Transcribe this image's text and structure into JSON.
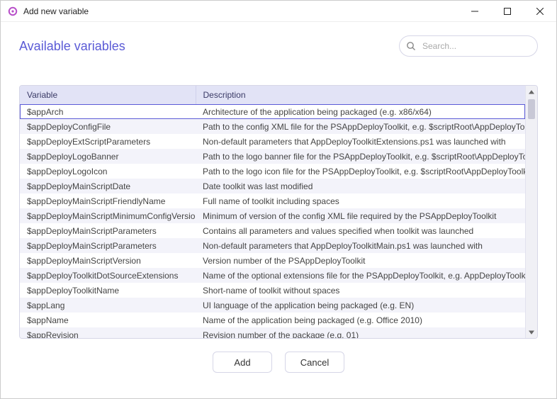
{
  "window": {
    "title": "Add new variable"
  },
  "heading": "Available variables",
  "search": {
    "placeholder": "Search..."
  },
  "table": {
    "headers": {
      "variable": "Variable",
      "description": "Description"
    },
    "rows": [
      {
        "variable": "$appArch",
        "description": "Architecture of the application being packaged (e.g. x86/x64)"
      },
      {
        "variable": "$appDeployConfigFile",
        "description": "Path to the config XML file for the PSAppDeployToolkit, e.g. $scriptRoot\\AppDeployToolkitCo"
      },
      {
        "variable": "$appDeployExtScriptParameters",
        "description": "Non-default parameters that AppDeployToolkitExtensions.ps1 was launched with"
      },
      {
        "variable": "$appDeployLogoBanner",
        "description": "Path to the logo banner file for the PSAppDeployToolkit, e.g. $scriptRoot\\AppDeployToolkitBa"
      },
      {
        "variable": "$appDeployLogoIcon",
        "description": "Path to the logo icon file for the PSAppDeployToolkit, e.g. $scriptRoot\\AppDeployToolkitLogo"
      },
      {
        "variable": "$appDeployMainScriptDate",
        "description": "Date toolkit was last modified"
      },
      {
        "variable": "$appDeployMainScriptFriendlyName",
        "description": " Full name of toolkit including spaces"
      },
      {
        "variable": "$appDeployMainScriptMinimumConfigVersion",
        "description": "Minimum of version of the config XML file required by the PSAppDeployToolkit"
      },
      {
        "variable": "$appDeployMainScriptParameters",
        "description": "Contains all parameters and values specified when toolkit was launched"
      },
      {
        "variable": "$appDeployMainScriptParameters",
        "description": "Non-default parameters that AppDeployToolkitMain.ps1 was launched with"
      },
      {
        "variable": "$appDeployMainScriptVersion",
        "description": " Version number of the PSAppDeployToolkit"
      },
      {
        "variable": "$appDeployToolkitDotSourceExtensions",
        "description": "Name of the optional extensions file for the PSAppDeployToolkit, e.g. AppDeployToolkitExten"
      },
      {
        "variable": "$appDeployToolkitName",
        "description": "Short-name of toolkit without spaces"
      },
      {
        "variable": "$appLang",
        "description": "UI language of the application being packaged (e.g. EN)"
      },
      {
        "variable": "$appName",
        "description": "Name of the application being packaged (e.g. Office 2010)"
      },
      {
        "variable": "$appRevision",
        "description": "Revision number of the package (e.g. 01)"
      }
    ]
  },
  "footer": {
    "add": "Add",
    "cancel": "Cancel"
  }
}
